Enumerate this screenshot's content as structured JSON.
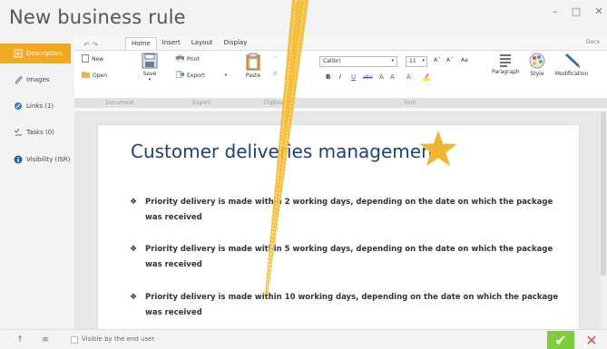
{
  "window": {
    "title": "New business rule",
    "minimize_glyph": "–",
    "maximize_glyph": "□",
    "close_glyph": "✕"
  },
  "sidebar": {
    "items": [
      {
        "label": "Description",
        "icon": "document-icon",
        "active": true
      },
      {
        "label": "Images",
        "icon": "paperclip-icon",
        "active": false
      },
      {
        "label": "Links (1)",
        "icon": "link-icon",
        "active": false
      },
      {
        "label": "Tasks (0)",
        "icon": "tasks-icon",
        "active": false
      },
      {
        "label": "Visibility (ISR)",
        "icon": "info-icon",
        "active": false
      }
    ]
  },
  "ribbon": {
    "quick_access": "↶  ↷",
    "tabs": [
      "Home",
      "Insert",
      "Layout",
      "Display"
    ],
    "docx_label": "Docx",
    "buttons": {
      "new": "New",
      "open": "Open",
      "save": "Save",
      "print": "Print",
      "export": "Export",
      "paste": "Paste",
      "paragraph": "Paragraph",
      "style": "Style",
      "modification": "Modification"
    },
    "font_name": "Calibri",
    "font_size": "11",
    "format_glyphs": [
      "B",
      "I",
      "U",
      "abc",
      "A",
      "A",
      "A"
    ],
    "grow_glyphs": [
      "A˄",
      "A˅",
      "Aa"
    ],
    "group_labels": [
      "Document",
      "Export",
      "Clipboard",
      "Font"
    ]
  },
  "document": {
    "title": "Customer deliveries management",
    "bullets": [
      "Priority delivery is made within 2 working days, depending on the date on which the package was received",
      "Priority delivery is made within 5 working days, depending on the date on which the package was received",
      "Priority delivery is made within 10 working days, depending on the date on which the package was received"
    ],
    "bullet_glyph": "❖"
  },
  "footer": {
    "visible_label": "Visible by the end user",
    "ok_glyph": "✔",
    "cancel_glyph": "✕",
    "up_glyph": "↑",
    "list_glyph": "≡"
  },
  "colors": {
    "accent": "#f2a922",
    "title_blue": "#1e3f77",
    "ok_green": "#7ccf3a",
    "cancel_red": "#d05050",
    "star": "#f2b530"
  }
}
